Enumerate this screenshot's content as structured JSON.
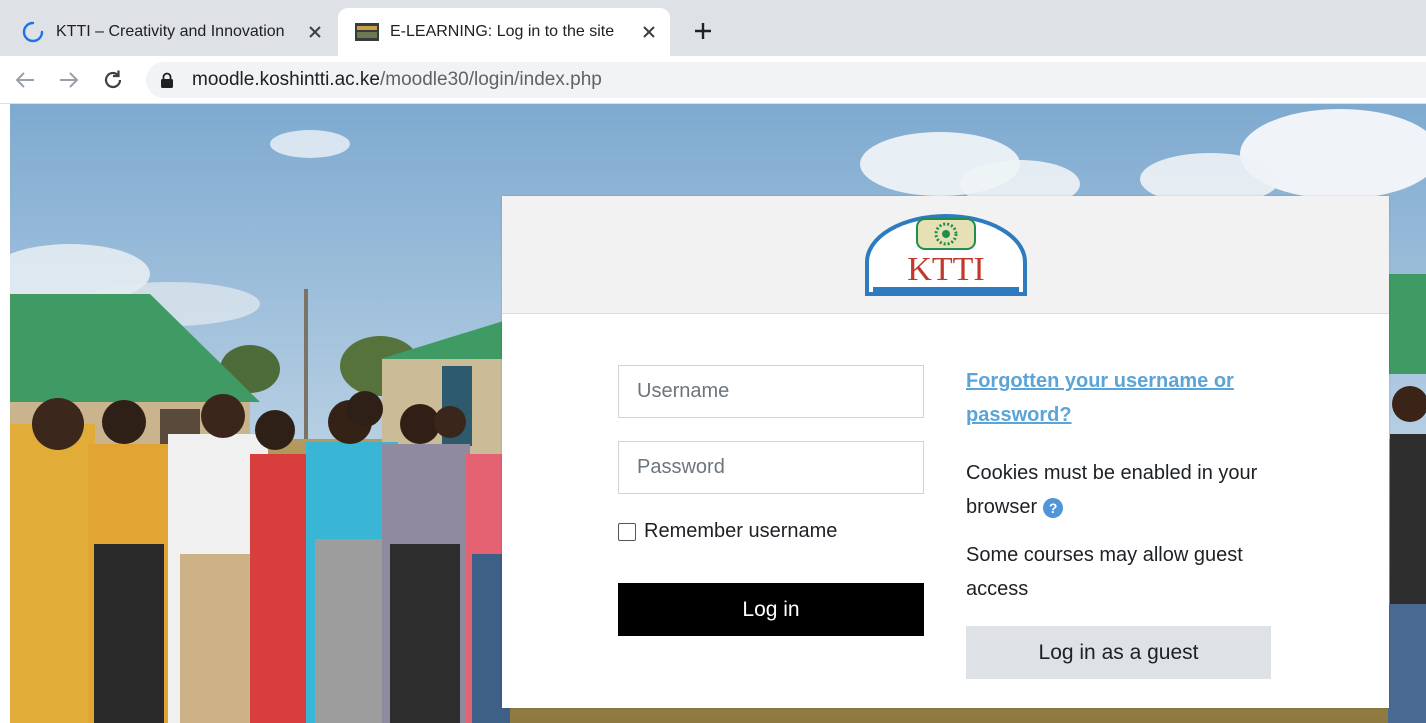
{
  "browser": {
    "tabs": [
      {
        "title": "KTTI – Creativity and Innovation",
        "icon": "loading-spinner-icon",
        "active": false
      },
      {
        "title": "E-LEARNING: Log in to the site",
        "icon": "site-favicon-icon",
        "active": true
      }
    ],
    "new_tab_icon": "plus-icon",
    "url_host": "moodle.koshintti.ac.ke",
    "url_path": "/moodle30/login/index.php",
    "accent": "#4f95d8"
  },
  "login": {
    "logo_text": "KTTI",
    "username_placeholder": "Username",
    "password_placeholder": "Password",
    "remember_label": "Remember username",
    "login_button": "Log in",
    "forgot_link": "Forgotten your username or password?",
    "cookies_note": "Cookies must be enabled in your browser",
    "guest_note": "Some courses may allow guest access",
    "guest_button": "Log in as a guest"
  }
}
